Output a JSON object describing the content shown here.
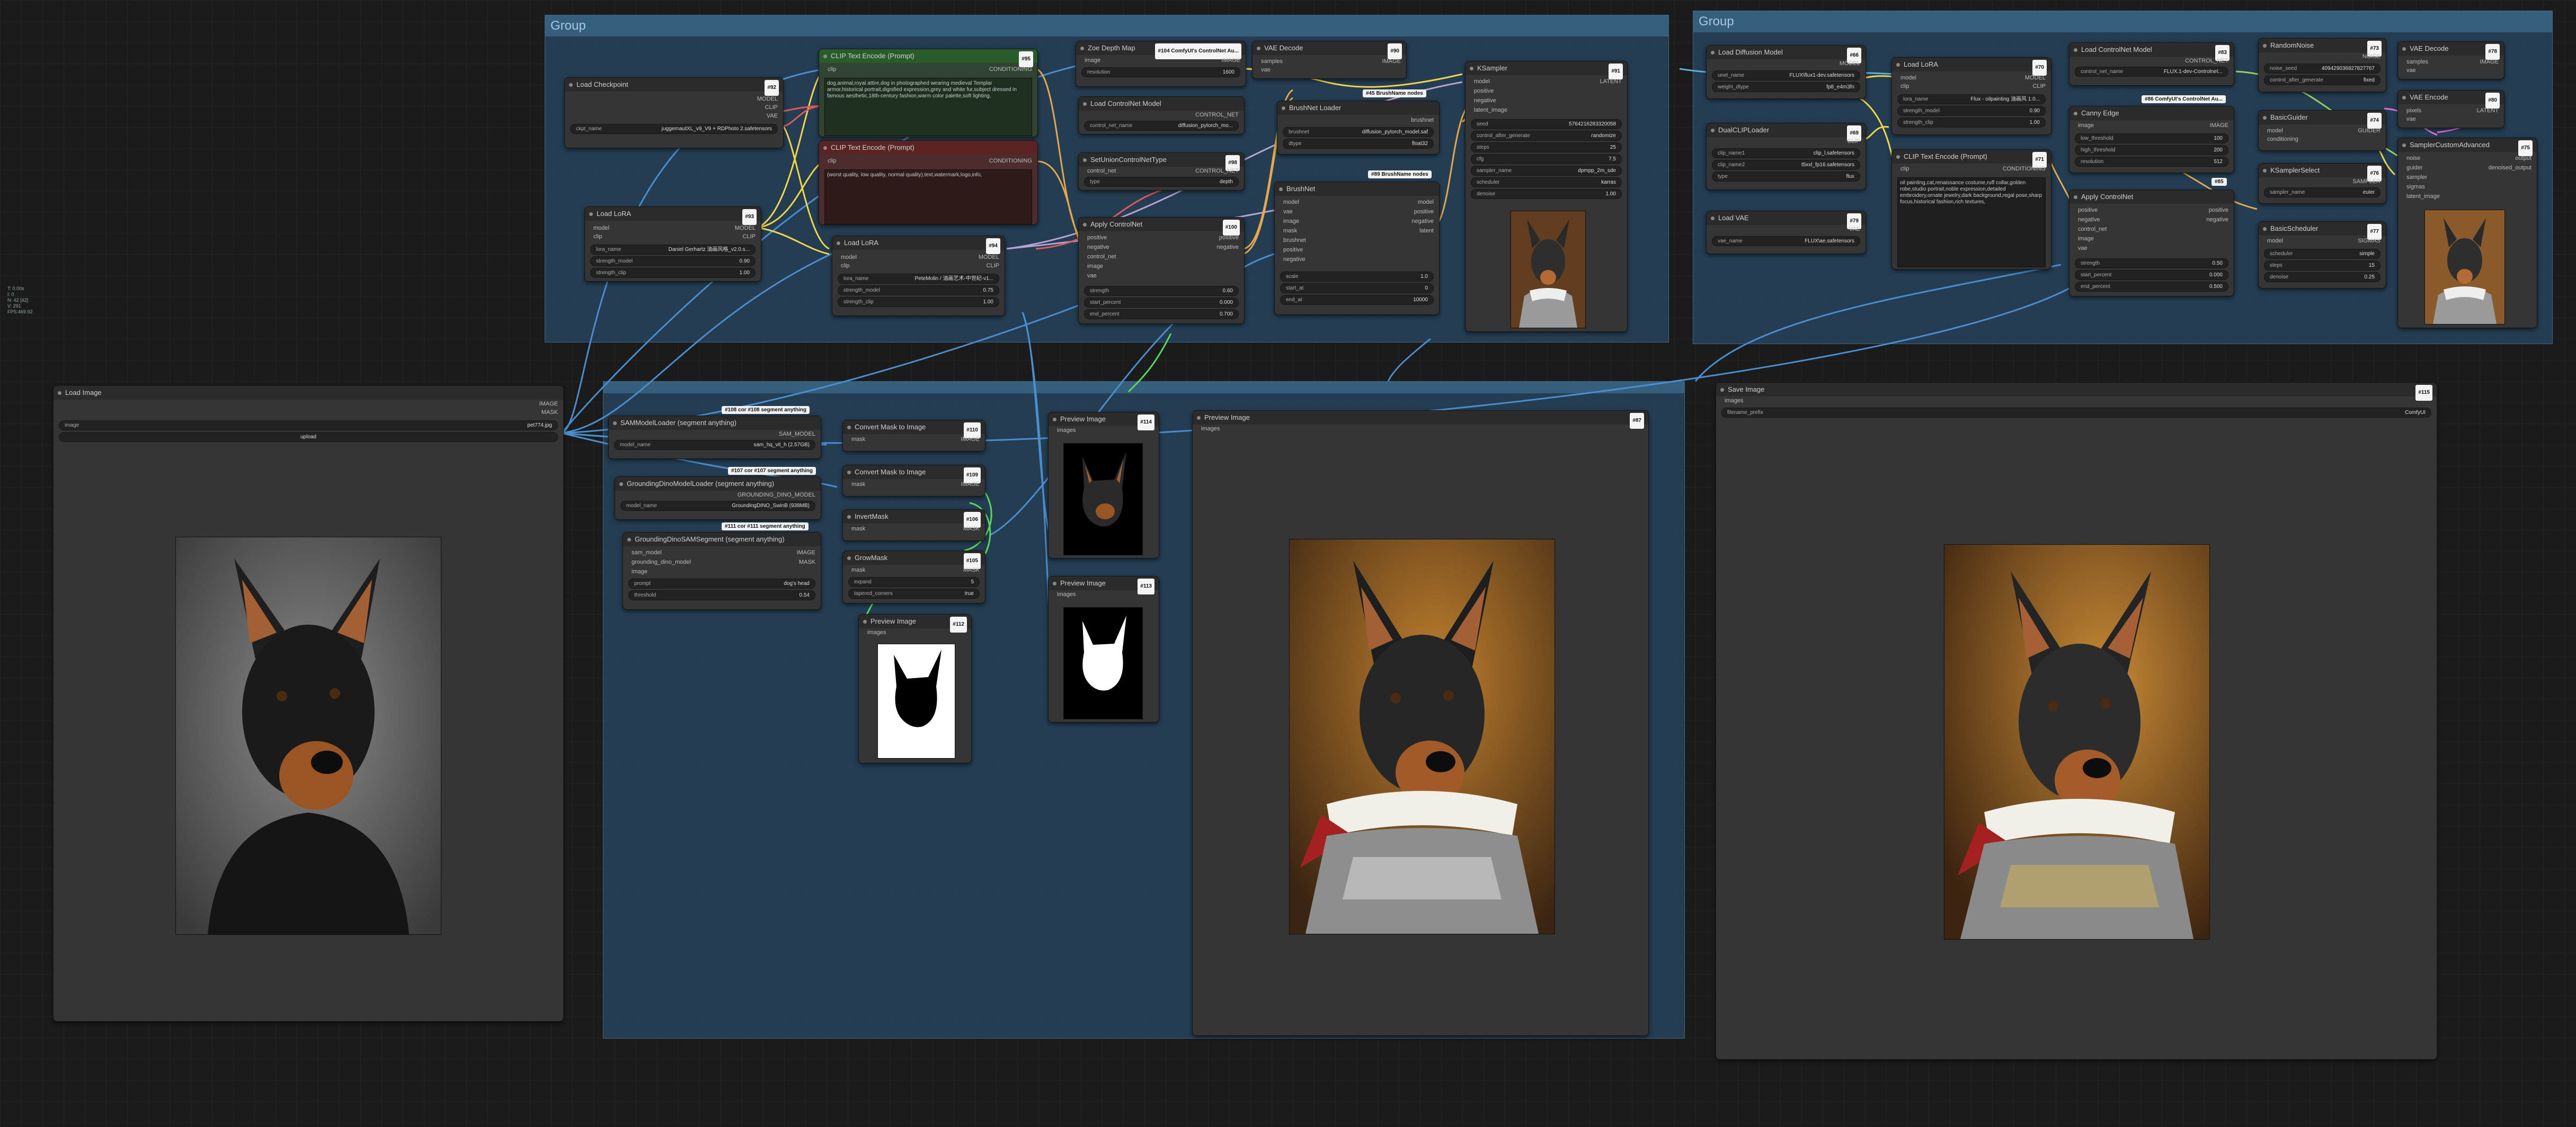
{
  "groups": {
    "top_left": "Group",
    "top_right": "Group"
  },
  "info": [
    "T: 0.00s",
    "I: 0",
    "N: 42 [42]",
    "V: 291",
    "FPS:469.92"
  ],
  "nodes": {
    "load_checkpoint": {
      "title": "Load Checkpoint",
      "badge": "#92",
      "ckpt_label": "ckpt_name",
      "ckpt_value": "juggernautXL_v9_V9 + RDPhoto 2.safetensors",
      "out1": "MODEL",
      "out2": "CLIP",
      "out3": "VAE"
    },
    "clip_pos": {
      "title": "CLIP Text Encode (Prompt)",
      "badge": "#95",
      "in": "clip",
      "out": "CONDITIONING",
      "text": "dog,animal,royal attire,dog in photographed wearing medieval Templar armor,historical portrait,dignified expression,grey and white fur,subject dressed in famous aesthetic,18th-century fashion,warm color palette,soft lighting,"
    },
    "clip_neg": {
      "title": "CLIP Text Encode (Prompt)",
      "badge": "",
      "in": "clip",
      "out": "CONDITIONING",
      "text": "(worst quality, low quality, normal quality),text,watermark,logo,info,"
    },
    "zoe": {
      "title": "Zoe Depth Map",
      "badge": "#104 ComfyUI's ControlNet Au...",
      "in": "image",
      "out": "IMAGE",
      "w_label": "resolution",
      "w_value": "1600"
    },
    "vae_decode_1": {
      "title": "VAE Decode",
      "badge": "#90",
      "in1": "samples",
      "in2": "vae",
      "out": "IMAGE"
    },
    "ksampler_1": {
      "title": "KSampler",
      "badge": "#91",
      "in1": "model",
      "in2": "positive",
      "in3": "negative",
      "in4": "latent_image",
      "out": "LATENT",
      "seed_l": "seed",
      "seed_v": "5764216283320058",
      "cag_l": "control_after_generate",
      "cag_v": "randomize",
      "steps_l": "steps",
      "steps_v": "25",
      "cfg_l": "cfg",
      "cfg_v": "7.5",
      "sampler_l": "sampler_name",
      "sampler_v": "dpmpp_2m_sde",
      "sched_l": "scheduler",
      "sched_v": "karras",
      "denoise_l": "denoise",
      "denoise_v": "1.00"
    },
    "load_cn_1": {
      "title": "Load ControlNet Model",
      "badge": "",
      "out": "CONTROL_NET",
      "w_label": "control_net_name",
      "w_value": "diffusion_pytorch_mo..."
    },
    "brushnet_loader": {
      "title": "BrushNet Loader",
      "badge": "#45 BrushName nodes",
      "out": "brushnet",
      "b_label": "brushnet",
      "b_value": "diffusion_pytorch_model.saf",
      "d_label": "dtype",
      "d_value": "float32"
    },
    "set_union": {
      "title": "SetUnionControlNetType",
      "badge": "#98",
      "in": "control_net",
      "out": "CONTROL_NET",
      "w_label": "type",
      "w_value": "depth"
    },
    "load_lora_1": {
      "title": "Load LoRA",
      "badge": "#93",
      "in1": "model",
      "in2": "clip",
      "out1": "MODEL",
      "out2": "CLIP",
      "l1": "lora_name",
      "v1": "Daniel Gerhartz 油画风格_v2.0.s...",
      "l2": "strength_model",
      "v2": "0.90",
      "l3": "strength_clip",
      "v3": "1.00"
    },
    "load_lora_2": {
      "title": "Load LoRA",
      "badge": "#94",
      "in1": "model",
      "in2": "clip",
      "out1": "MODEL",
      "out2": "CLIP",
      "l1": "lora_name",
      "v1": "PeteMolin / 油画艺术-中世纪-v1...",
      "l2": "strength_model",
      "v2": "0.75",
      "l3": "strength_clip",
      "v3": "1.00"
    },
    "apply_cn_1": {
      "title": "Apply ControlNet",
      "badge": "#100",
      "in1": "positive",
      "in2": "negative",
      "in3": "control_net",
      "in4": "image",
      "in5": "vae",
      "out1": "positive",
      "out2": "negative",
      "l1": "strength",
      "v1": "0.60",
      "l2": "start_percent",
      "v2": "0.000",
      "l3": "end_percent",
      "v3": "0.700"
    },
    "brushnet": {
      "title": "BrushNet",
      "badge": "#89 BrushName nodes",
      "in": [
        "model",
        "vae",
        "image",
        "mask",
        "brushnet",
        "positive",
        "negative"
      ],
      "out": [
        "model",
        "positive",
        "negative",
        "latent"
      ],
      "l1": "scale",
      "v1": "1.0",
      "l2": "start_at",
      "v2": "0",
      "l3": "end_at",
      "v3": "10000"
    },
    "load_diffusion": {
      "title": "Load Diffusion Model",
      "badge": "#66",
      "out": "MODEL",
      "l1": "unet_name",
      "v1": "FLUX\\flux1-dev.safetensors",
      "l2": "weight_dtype",
      "v2": "fp8_e4m3fn"
    },
    "dual_clip": {
      "title": "DualCLIPLoader",
      "badge": "#69",
      "out": "CLIP",
      "l1": "clip_name1",
      "v1": "clip_l.safetensors",
      "l2": "clip_name2",
      "v2": "t5xxl_fp16.safetensors",
      "l3": "type",
      "v3": "flux"
    },
    "load_vae": {
      "title": "Load VAE",
      "badge": "#79",
      "out": "VAE",
      "l1": "vae_name",
      "v1": "FLUX\\ae.safetensors"
    },
    "load_lora_3": {
      "title": "Load LoRA",
      "badge": "#70",
      "in1": "model",
      "in2": "clip",
      "out1": "MODEL",
      "out2": "CLIP",
      "l1": "lora_name",
      "v1": "Flux - oilpainting 油画风 1.0...",
      "l2": "strength_model",
      "v2": "0.90",
      "l3": "strength_clip",
      "v3": "1.00"
    },
    "clip_flux": {
      "title": "CLIP Text Encode (Prompt)",
      "badge": "#71",
      "in": "clip",
      "out": "CONDITIONING",
      "text": "oil painting,cat,renaissance costume,ruff collar,golden robe,studio portrait,noble expression,detailed embroidery,ornate jewelry,dark background,regal pose,sharp focus,historical fashion,rich textures,"
    },
    "load_cn_2": {
      "title": "Load ControlNet Model",
      "badge": "#83",
      "out": "CONTROL_NET",
      "l1": "control_net_name",
      "v1": "FLUX.1-dev-Controlnet...",
      "extra": "#86 ComfyUI's ControlNet Au..."
    },
    "canny": {
      "title": "Canny Edge",
      "badge": "#84",
      "in": "image",
      "out": "IMAGE",
      "l1": "low_threshold",
      "v1": "100",
      "l2": "high_threshold",
      "v2": "200",
      "l3": "resolution",
      "v3": "512"
    },
    "apply_cn_2": {
      "title": "Apply ControlNet",
      "badge": "#85",
      "in1": "positive",
      "in2": "negative",
      "in3": "control_net",
      "in4": "image",
      "in5": "vae",
      "out1": "positive",
      "out2": "negative",
      "l1": "strength",
      "v1": "0.50",
      "l2": "start_percent",
      "v2": "0.000",
      "l3": "end_percent",
      "v3": "0.500"
    },
    "random_noise": {
      "title": "RandomNoise",
      "badge": "#73",
      "out": "NOISE",
      "l1": "noise_seed",
      "v1": "409429036827827767",
      "l2": "control_after_generate",
      "v2": "fixed"
    },
    "basic_guider": {
      "title": "BasicGuider",
      "badge": "#74",
      "in1": "model",
      "in2": "conditioning",
      "out": "GUIDER"
    },
    "ksampler_select": {
      "title": "KSamplerSelect",
      "badge": "#76",
      "out": "SAMPLER",
      "l1": "sampler_name",
      "v1": "euler"
    },
    "basic_scheduler": {
      "title": "BasicScheduler",
      "badge": "#77",
      "in": "model",
      "out": "SIGMAS",
      "l1": "scheduler",
      "v1": "simple",
      "l2": "steps",
      "v2": "15",
      "l3": "denoise",
      "v3": "0.25"
    },
    "vae_decode_2": {
      "title": "VAE Decode",
      "badge": "#78",
      "in1": "samples",
      "in2": "vae",
      "out": "IMAGE"
    },
    "vae_encode": {
      "title": "VAE Encode",
      "badge": "#80",
      "in1": "pixels",
      "in2": "vae",
      "out": "LATENT"
    },
    "sampler_custom": {
      "title": "SamplerCustomAdvanced",
      "badge": "#75",
      "in": [
        "noise",
        "guider",
        "sampler",
        "sigmas",
        "latent_image"
      ],
      "out1": "output",
      "out2": "denoised_output"
    },
    "load_image": {
      "title": "Load Image",
      "badge": "#88",
      "out1": "IMAGE",
      "out2": "MASK",
      "l1": "image",
      "v1": "pet774.jpg",
      "upload": "upload"
    },
    "sam_loader": {
      "title": "SAMModelLoader (segment anything)",
      "badge": "#108 cor #108 segment anything",
      "out": "SAM_MODEL",
      "l1": "model_name",
      "v1": "sam_hq_vit_h (2.57GB)"
    },
    "gd_loader": {
      "title": "GroundingDinoModelLoader (segment anything)",
      "badge": "#107 cor #107 segment anything",
      "out": "GROUNDING_DINO_MODEL",
      "l1": "model_name",
      "v1": "GroundingDINO_SwinB (938MB)"
    },
    "gd_sam": {
      "title": "GroundingDinoSAMSegment (segment anything)",
      "badge": "#111 cor #111 segment anything",
      "in": [
        "sam_model",
        "grounding_dino_model",
        "image"
      ],
      "out1": "IMAGE",
      "out2": "MASK",
      "l1": "prompt",
      "v1": "dog's head",
      "l2": "threshold",
      "v2": "0.54"
    },
    "cmi_1": {
      "title": "Convert Mask to Image",
      "badge": "#110",
      "in": "mask",
      "out": "IMAGE"
    },
    "cmi_2": {
      "title": "Convert Mask to Image",
      "badge": "#109",
      "in": "mask",
      "out": "IMAGE"
    },
    "invert": {
      "title": "InvertMask",
      "badge": "#106",
      "in": "mask",
      "out": "MASK"
    },
    "grow": {
      "title": "GrowMask",
      "badge": "#105",
      "in": "mask",
      "out": "MASK",
      "l1": "expand",
      "v1": "5",
      "l2": "tapered_corners",
      "v2": "true"
    },
    "prev_1": {
      "title": "Preview Image",
      "badge": "#114",
      "in": "images"
    },
    "prev_2": {
      "title": "Preview Image",
      "badge": "#113",
      "in": "images"
    },
    "prev_3": {
      "title": "Preview Image",
      "badge": "#112",
      "in": "images"
    },
    "prev_4": {
      "title": "Preview Image",
      "badge": "#87",
      "in": "images"
    },
    "save_image": {
      "title": "Save Image",
      "badge": "#115",
      "in": "images",
      "l1": "filename_prefix",
      "v1": "ComfyUI"
    }
  }
}
